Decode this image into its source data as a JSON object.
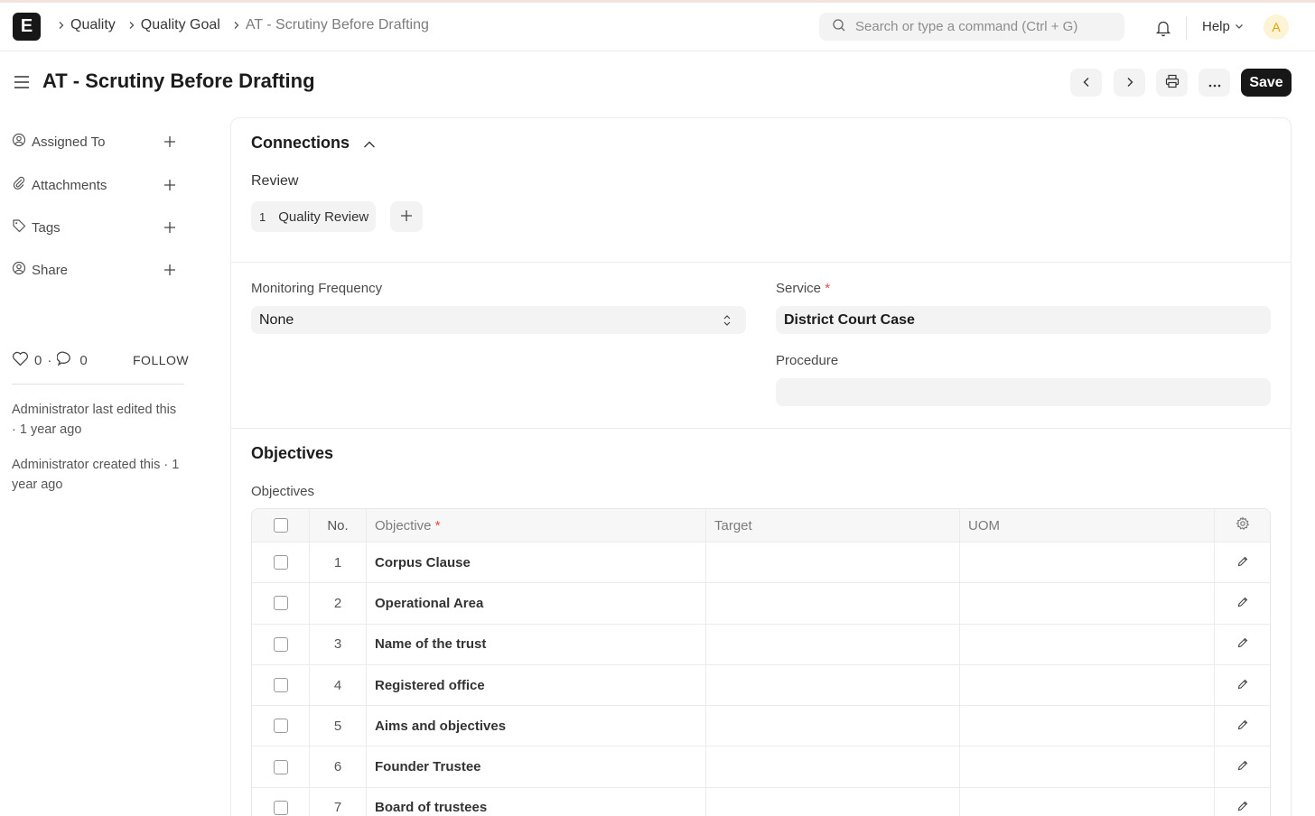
{
  "navbar": {
    "logo_letter": "E",
    "breadcrumbs": [
      "Quality",
      "Quality Goal",
      "AT - Scrutiny Before Drafting"
    ],
    "search_placeholder": "Search or type a command (Ctrl + G)",
    "help_label": "Help",
    "avatar_letter": "A"
  },
  "page": {
    "title": "AT - Scrutiny Before Drafting",
    "save_label": "Save"
  },
  "sidebar": {
    "items": [
      {
        "label": "Assigned To",
        "icon": "assign-icon"
      },
      {
        "label": "Attachments",
        "icon": "paperclip-icon"
      },
      {
        "label": "Tags",
        "icon": "tag-icon"
      },
      {
        "label": "Share",
        "icon": "share-icon"
      }
    ],
    "likes": "0",
    "comments": "0",
    "dot": "·",
    "follow_label": "FOLLOW",
    "activity": [
      "Administrator last edited this · 1 year ago",
      "Administrator created this · 1 year ago"
    ]
  },
  "connections": {
    "title": "Connections",
    "group_label": "Review",
    "link_count": "1",
    "link_label": "Quality Review"
  },
  "form": {
    "monitoring_label": "Monitoring Frequency",
    "monitoring_value": "None",
    "service_label": "Service",
    "service_value": "District Court Case",
    "procedure_label": "Procedure",
    "procedure_value": "",
    "required_mark": "*"
  },
  "objectives": {
    "section_title": "Objectives",
    "table_label": "Objectives",
    "columns": {
      "no": "No.",
      "objective": "Objective",
      "target": "Target",
      "uom": "UOM"
    },
    "rows": [
      {
        "no": "1",
        "objective": "Corpus Clause",
        "target": "",
        "uom": ""
      },
      {
        "no": "2",
        "objective": "Operational Area",
        "target": "",
        "uom": ""
      },
      {
        "no": "3",
        "objective": "Name of the trust",
        "target": "",
        "uom": ""
      },
      {
        "no": "4",
        "objective": "Registered office",
        "target": "",
        "uom": ""
      },
      {
        "no": "5",
        "objective": "Aims and objectives",
        "target": "",
        "uom": ""
      },
      {
        "no": "6",
        "objective": "Founder Trustee",
        "target": "",
        "uom": ""
      },
      {
        "no": "7",
        "objective": "Board of trustees",
        "target": "",
        "uom": ""
      }
    ]
  }
}
